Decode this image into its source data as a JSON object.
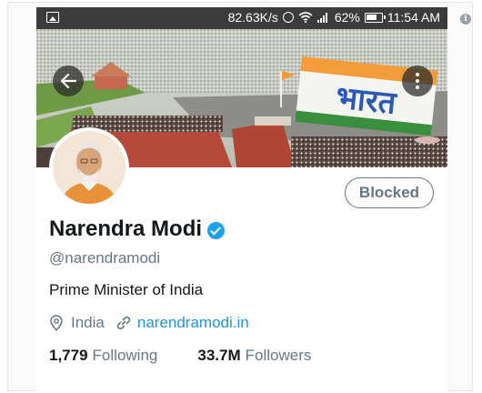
{
  "statusbar": {
    "speed": "82.63K/s",
    "battery_percent": "62%",
    "time": "11:54 AM",
    "icons": [
      "image-icon",
      "alarm-icon",
      "wifi-icon",
      "signal-icon",
      "battery-icon"
    ]
  },
  "header": {
    "back_icon": "back-arrow-icon",
    "more_icon": "more-vertical-icon"
  },
  "profile": {
    "display_name": "Narendra Modi",
    "handle": "@narendramodi",
    "bio": "Prime Minister of India",
    "location": "India",
    "website": "narendramodi.in",
    "verified": true,
    "blocked_label": "Blocked",
    "following_count": "1,779",
    "following_label": "Following",
    "followers_count": "33.7M",
    "followers_label": "Followers"
  },
  "banner": {
    "crowd_text": "भारत"
  },
  "colors": {
    "accent": "#1da1f2",
    "link": "#1b95e0",
    "muted": "#657786",
    "text": "#14171a",
    "statusbar": "#3b3b3b"
  }
}
